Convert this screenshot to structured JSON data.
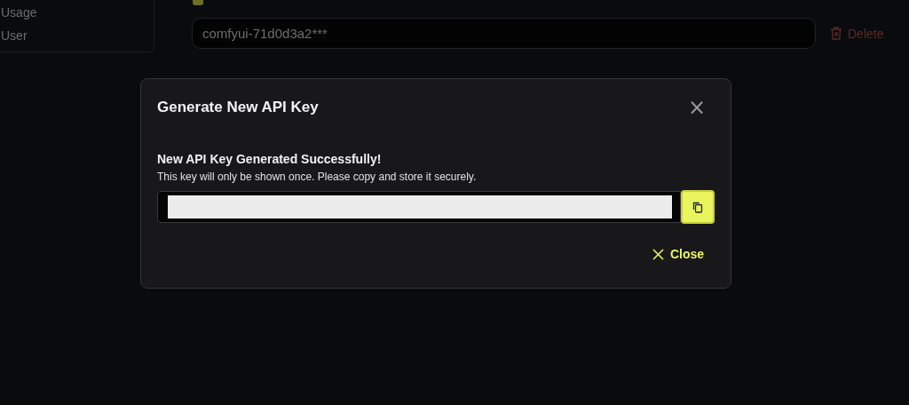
{
  "sidebar": {
    "items": [
      {
        "label": "Usage",
        "selected": false
      },
      {
        "label": "User",
        "selected": false
      }
    ]
  },
  "api_keys": [
    {
      "value": "comfyui-71d0d3a2***",
      "action": "Delete"
    }
  ],
  "dialog": {
    "title": "Generate New API Key",
    "close_glyph": "×",
    "heading": "New API Key Generated Successfully!",
    "description": "This key will only be shown once. Please copy and store it securely.",
    "key_field": {
      "redacted": true
    },
    "close_button": "Close"
  }
}
